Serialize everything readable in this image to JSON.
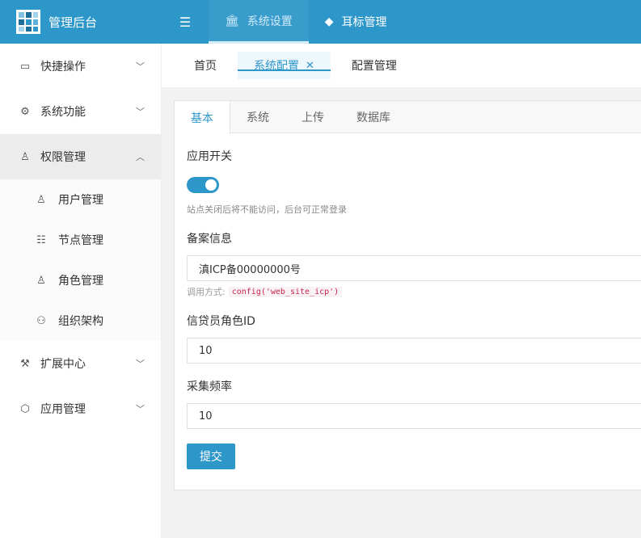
{
  "header": {
    "title": "管理后台",
    "menu_toggle_icon": "menu-fold-icon",
    "nav": [
      {
        "label": "系统设置",
        "icon": "bank-icon",
        "active": true
      },
      {
        "label": "耳标管理",
        "icon": "tag-icon",
        "active": false
      }
    ]
  },
  "sidebar": {
    "items": [
      {
        "label": "快捷操作",
        "icon": "folder-icon"
      },
      {
        "label": "系统功能",
        "icon": "gear-icon"
      },
      {
        "label": "权限管理",
        "icon": "user-icon",
        "open": true,
        "children": [
          {
            "label": "用户管理",
            "icon": "person-icon"
          },
          {
            "label": "节点管理",
            "icon": "list-icon"
          },
          {
            "label": "角色管理",
            "icon": "role-icon"
          },
          {
            "label": "组织架构",
            "icon": "org-icon"
          }
        ]
      },
      {
        "label": "扩展中心",
        "icon": "robot-arm-icon"
      },
      {
        "label": "应用管理",
        "icon": "cube-icon"
      }
    ]
  },
  "tabs": [
    {
      "label": "首页"
    },
    {
      "label": "系统配置",
      "active": true,
      "close": "✕"
    },
    {
      "label": "配置管理"
    }
  ],
  "config": {
    "subtabs": [
      "基本",
      "系统",
      "上传",
      "数据库"
    ],
    "switch_label": "应用开关",
    "switch_on": true,
    "switch_hint": "站点关闭后将不能访问，后台可正常登录",
    "icp_label": "备案信息",
    "icp_value": "滇ICP备00000000号",
    "call_label": "调用方式:",
    "call_code": "config('web_site_icp')",
    "role_label": "信贷员角色ID",
    "role_value": "10",
    "freq_label": "采集频率",
    "freq_value": "10",
    "submit_label": "提交"
  },
  "colors": {
    "accent": "#2d97c9"
  }
}
